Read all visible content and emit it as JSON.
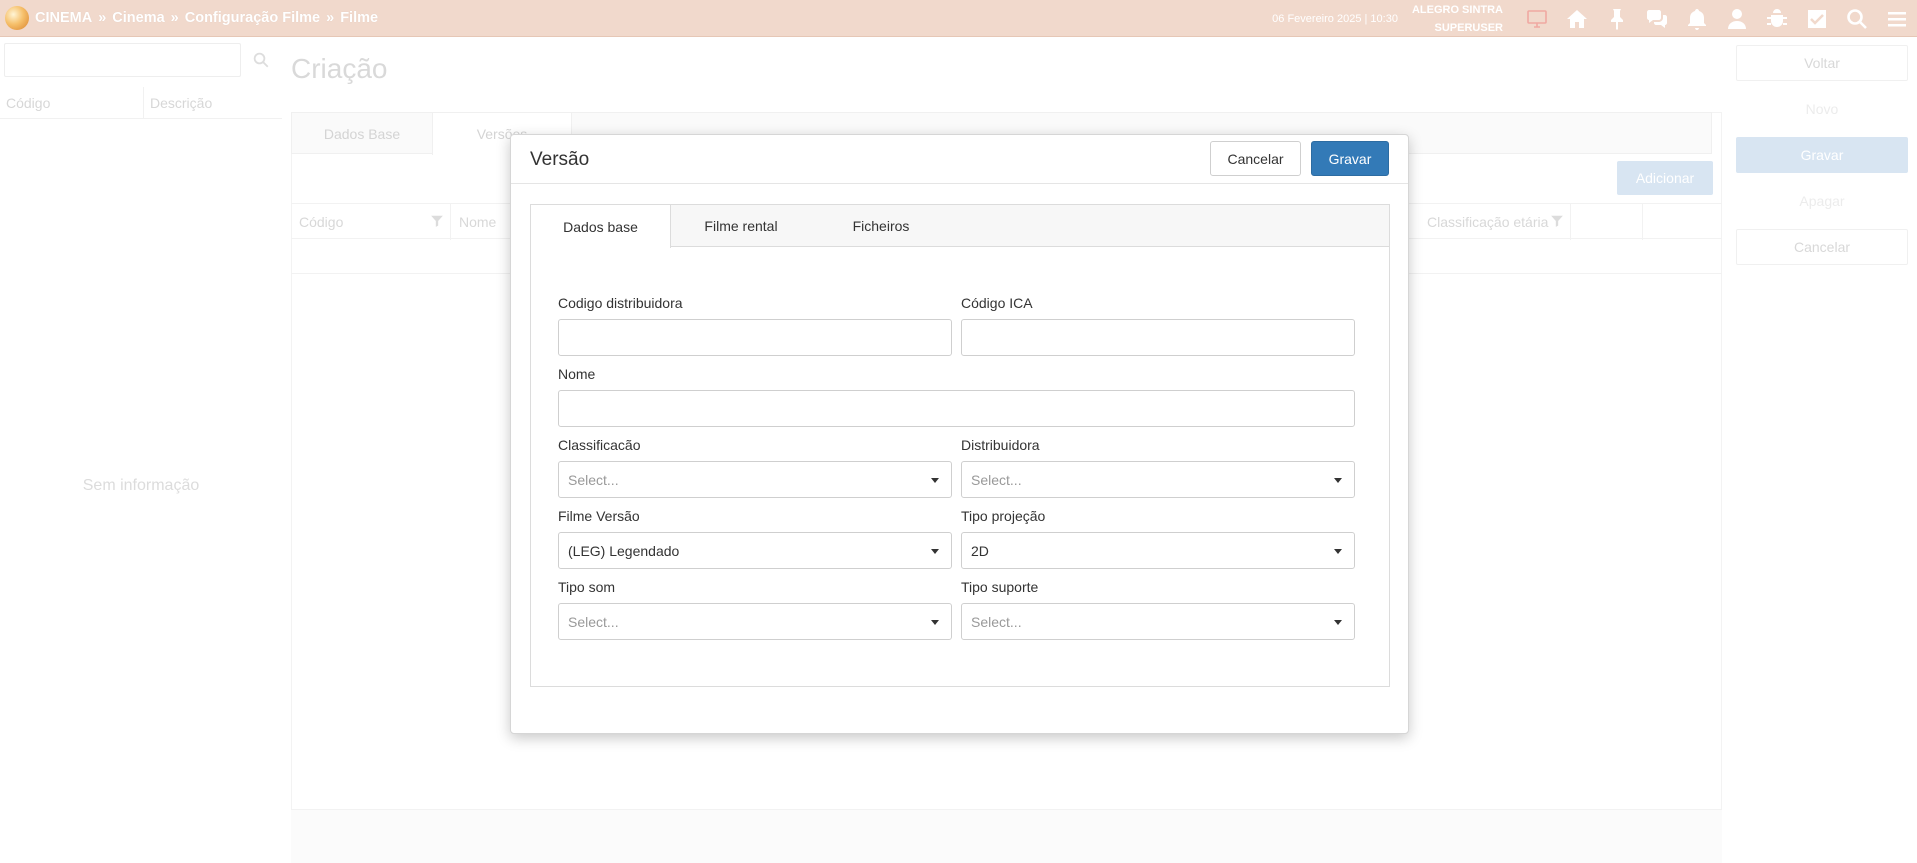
{
  "topbar": {
    "breadcrumb": [
      "CINEMA",
      "Cinema",
      "Configuração Filme",
      "Filme"
    ],
    "separator": "»",
    "datetime": "06 Fevereiro 2025 | 10:30",
    "user_name": "ALEGRO SINTRA",
    "user_role": "SUPERUSER",
    "icons": [
      "monitor-icon",
      "home-icon",
      "pin-icon",
      "chat-icon",
      "bell-icon",
      "user-icon",
      "bug-icon",
      "check-square-icon",
      "search-icon",
      "menu-icon"
    ]
  },
  "left_panel": {
    "columns": [
      "Código",
      "Descrição"
    ],
    "empty_text": "Sem informação"
  },
  "main": {
    "title": "Criação",
    "tabs": [
      "Dados Base",
      "Versões"
    ],
    "add_button": "Adicionar",
    "grid_columns": [
      "Código",
      "Nome",
      "Classificação etária"
    ]
  },
  "right_panel": {
    "buttons": [
      "Voltar",
      "Novo",
      "Gravar",
      "Apagar",
      "Cancelar"
    ]
  },
  "modal": {
    "title": "Versão",
    "cancel_label": "Cancelar",
    "save_label": "Gravar",
    "tabs": [
      "Dados base",
      "Filme rental",
      "Ficheiros"
    ],
    "active_tab": "Dados base",
    "fields": {
      "codigo_distribuidora": {
        "label": "Codigo distribuidora",
        "value": ""
      },
      "codigo_ica": {
        "label": "Código ICA",
        "value": ""
      },
      "nome": {
        "label": "Nome",
        "value": ""
      },
      "classificacao": {
        "label": "Classificacão",
        "placeholder": "Select..."
      },
      "distribuidora": {
        "label": "Distribuidora",
        "placeholder": "Select..."
      },
      "filme_versao": {
        "label": "Filme Versão",
        "value": "(LEG) Legendado"
      },
      "tipo_projecao": {
        "label": "Tipo projeção",
        "value": "2D"
      },
      "tipo_som": {
        "label": "Tipo som",
        "placeholder": "Select..."
      },
      "tipo_suporte": {
        "label": "Tipo suporte",
        "placeholder": "Select..."
      }
    }
  },
  "colors": {
    "topbar": "#f1d9cc",
    "primary": "#337ab7"
  }
}
